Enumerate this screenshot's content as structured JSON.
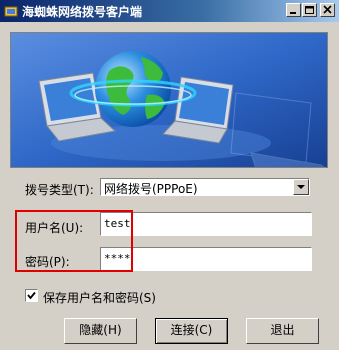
{
  "window": {
    "title": "海蜘蛛网络拨号客户端",
    "controls": {
      "minimize": "minimize",
      "maximize": "maximize",
      "close": "close"
    }
  },
  "form": {
    "dial_type_label": "拨号类型(T):",
    "dial_type_value": "网络拨号(PPPoE)",
    "username_label": "用户名(U):",
    "username_value": "test",
    "password_label": "密码(P):",
    "password_value": "****",
    "save_label": "保存用户名和密码(S)",
    "save_checked": true
  },
  "buttons": {
    "hide": "隐藏(H)",
    "connect": "连接(C)",
    "exit": "退出"
  },
  "colors": {
    "title_bar": "#0a246a",
    "banner_bg": "#2f68c8",
    "highlight": "#e00000",
    "face": "#d4d0c8"
  },
  "icons": [
    "app-icon",
    "globe-icon",
    "laptop-icon",
    "dropdown-arrow-icon",
    "checkmark-icon"
  ]
}
